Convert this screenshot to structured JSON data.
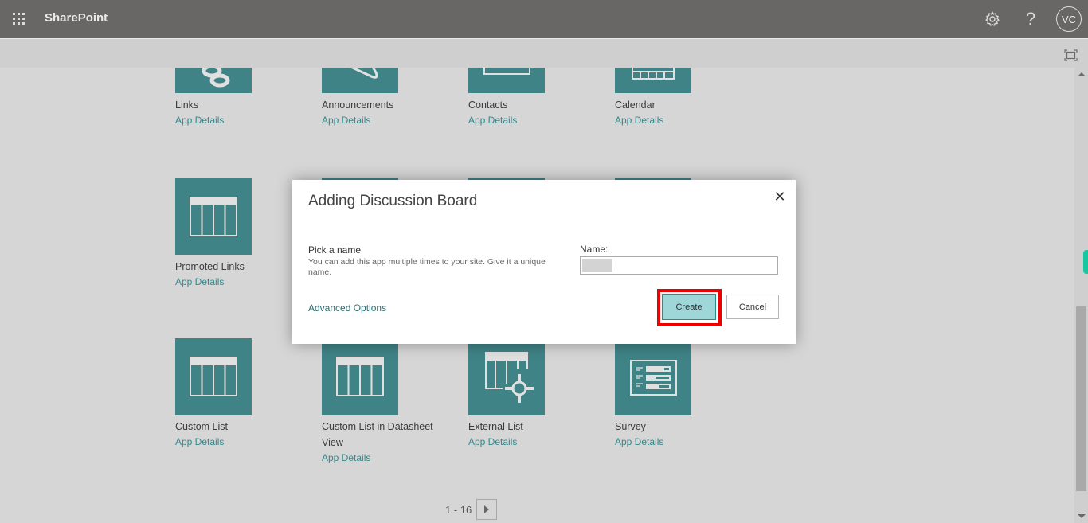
{
  "suitebar": {
    "app_name": "SharePoint",
    "settings_icon": "gear-icon",
    "help_label": "?",
    "avatar_initials": "VC"
  },
  "tiles": [
    {
      "title": "Links",
      "link": "App Details",
      "icon": "link-icon"
    },
    {
      "title": "Announcements",
      "link": "App Details",
      "icon": "megaphone-icon"
    },
    {
      "title": "Contacts",
      "link": "App Details",
      "icon": "contact-card-icon"
    },
    {
      "title": "Calendar",
      "link": "App Details",
      "icon": "calendar-icon"
    },
    {
      "title": "Promoted Links",
      "link": "App Details",
      "icon": "list-icon"
    },
    {
      "title": "Custom List",
      "link": "App Details",
      "icon": "list-icon"
    },
    {
      "title": "Custom List in Datasheet View",
      "link": "App Details",
      "icon": "list-icon"
    },
    {
      "title": "External List",
      "link": "App Details",
      "icon": "external-list-icon"
    },
    {
      "title": "Survey",
      "link": "App Details",
      "icon": "survey-icon"
    }
  ],
  "pager": {
    "range": "1 - 16"
  },
  "dialog": {
    "title": "Adding Discussion Board",
    "close_label": "✕",
    "pick_label": "Pick a name",
    "pick_description": "You can add this app multiple times to your site. Give it a unique name.",
    "name_label": "Name:",
    "name_value": "",
    "advanced_label": "Advanced Options",
    "create_label": "Create",
    "cancel_label": "Cancel"
  },
  "colors": {
    "suitebar": "#696766",
    "tile": "#3f8386",
    "link": "#33888b",
    "create_button": "#9fd7d9",
    "highlight": "#ee0000"
  }
}
